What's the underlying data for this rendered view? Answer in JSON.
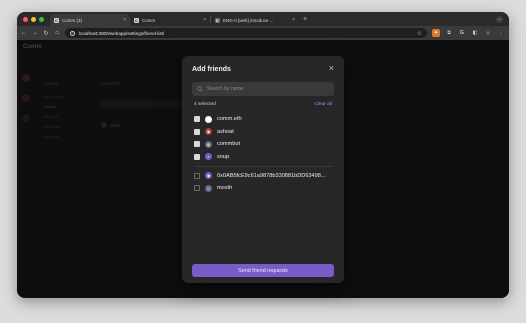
{
  "browser": {
    "tabs": [
      {
        "title": "Comm (3)",
        "favicon": "C",
        "active": true
      },
      {
        "title": "Comm",
        "favicon": "C",
        "active": false
      },
      {
        "title": "ENG-0 [web] introduce ...",
        "favicon": "E",
        "active": false
      }
    ],
    "new_tab_icon": "plus-icon",
    "url": "localhost:3000/webapp/settings/friend-list/"
  },
  "app": {
    "name": "Comm",
    "settings_heading": "Settings",
    "settings_items": [
      "My account",
      "Friends",
      "Block list",
      "Keyserver",
      "Build info"
    ],
    "content_heading": "Friend list"
  },
  "modal": {
    "title": "Add friends",
    "close_icon": "close-icon",
    "search": {
      "placeholder": "Search by name",
      "value": ""
    },
    "selected_count": "4 selected",
    "clear_all": "Clear all",
    "selected_users": [
      {
        "name": "comm.eth",
        "avatar_color": "#ffffff",
        "avatar_glyph": ""
      },
      {
        "name": "ashoat",
        "avatar_color": "#a5413a",
        "avatar_glyph": "◉"
      },
      {
        "name": "commbot",
        "avatar_color": "#6b6b7a",
        "avatar_glyph": "◍"
      },
      {
        "name": "soup",
        "avatar_color": "#7a5cc9",
        "avatar_glyph": "◐"
      }
    ],
    "other_users": [
      {
        "name": "0x0AB5fcE9c61a9878b330881bDD63498...",
        "avatar_color": "#7a5cc9",
        "avatar_glyph": "◆"
      },
      {
        "name": "mosth",
        "avatar_color": "#5a6f80",
        "avatar_glyph": "☺"
      }
    ],
    "send_label": "Send friend requests"
  },
  "colors": {
    "accent": "#7a5cc9",
    "link": "#9b8cf2",
    "modal_bg": "#27272a"
  }
}
